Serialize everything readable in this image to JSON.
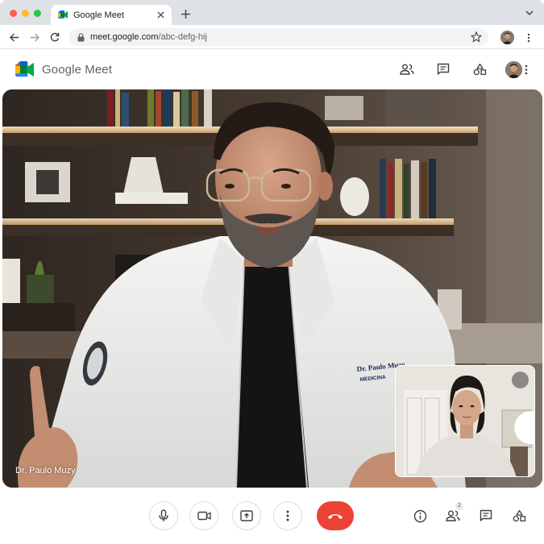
{
  "browser": {
    "tab_title": "Google Meet",
    "url_host": "meet.google.com",
    "url_path": "/abc-defg-hij"
  },
  "app": {
    "name": "Google Meet"
  },
  "call": {
    "speaker_name": "Dr. Paulo Muzy",
    "coat_name_tag": "Dr. Paulo Muzy",
    "coat_subtitle": "MEDICINA",
    "participant_badge": "2"
  },
  "icons": {
    "header": [
      "people-icon",
      "chat-icon",
      "activities-icon"
    ],
    "controls": [
      "mic-icon",
      "camera-icon",
      "present-icon",
      "more-icon",
      "hangup-icon"
    ],
    "side": [
      "info-icon",
      "people-icon",
      "chat-icon",
      "activities-icon"
    ]
  },
  "colors": {
    "hangup": "#ea4335",
    "icon": "#3c4043",
    "meet_green": "#00832d",
    "meet_blue": "#0066da",
    "meet_yellow": "#ffba00",
    "meet_red": "#e94235"
  }
}
